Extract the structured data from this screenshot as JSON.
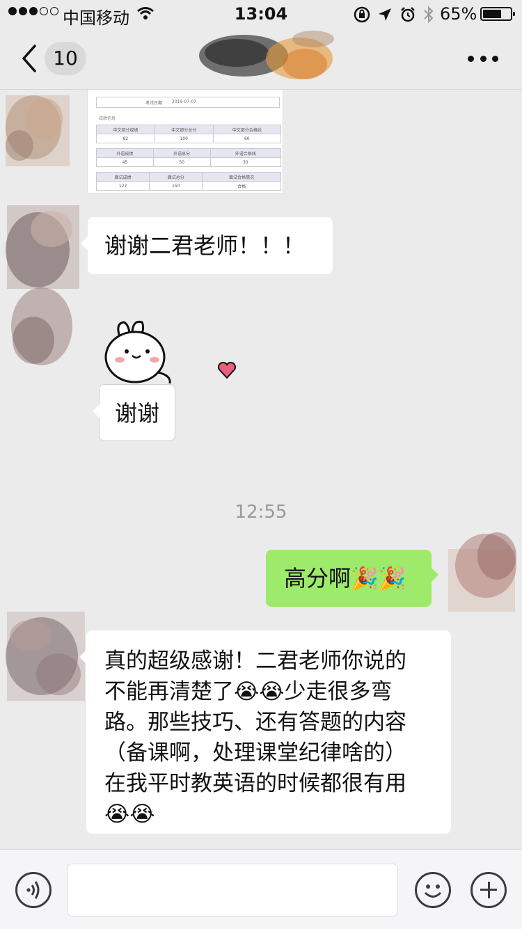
{
  "status_bar": {
    "carrier": "中国移动",
    "time": "13:04",
    "battery": "65%",
    "battery_level": 0.65,
    "icons": [
      "signal-dots",
      "wifi-icon",
      "orientation-lock-icon",
      "location-arrow-icon",
      "alarm-icon",
      "bluetooth-icon",
      "battery-icon"
    ]
  },
  "nav": {
    "unread_count": "10",
    "icons": [
      "back-chevron-icon",
      "more-dots-icon"
    ]
  },
  "messages": {
    "doc_image": {
      "header_key": "考试日期",
      "header_value": "2019-07-07",
      "caption": "成绩信息",
      "rows": [
        [
          "中文部分成绩",
          "中文部分总分",
          "中文部分合格线"
        ],
        [
          "82",
          "100",
          "60"
        ],
        [
          "外语成绩",
          "外语总分",
          "外语合格线"
        ],
        [
          "45",
          "50",
          "30"
        ],
        [
          "面试成绩",
          "面试总分",
          "面试合格情况"
        ],
        [
          "127",
          "150",
          "合格"
        ]
      ]
    },
    "thanks_teacher": "谢谢二君老师！！！",
    "sticker_caption": "谢谢",
    "timestamp": "12:55",
    "high_score": "高分啊🎉🎉",
    "long_line1": "真的超级感谢！二君老师你说的",
    "long_line2": "不能再清楚了😭😭少走很多弯",
    "long_line3": "路。那些技巧、还有答题的内容",
    "long_line4": "（备课啊，处理课堂纪律啥的）",
    "long_line5": "在我平时教英语的时候都很有用",
    "long_line6": "😭😭"
  },
  "input_bar": {
    "icons": [
      "voice-icon",
      "emoji-icon",
      "plus-icon"
    ]
  },
  "colors": {
    "background": "#ebebeb",
    "sent_bubble": "#9eea6a",
    "received_bubble": "#ffffff",
    "heart": "#e8607a"
  }
}
